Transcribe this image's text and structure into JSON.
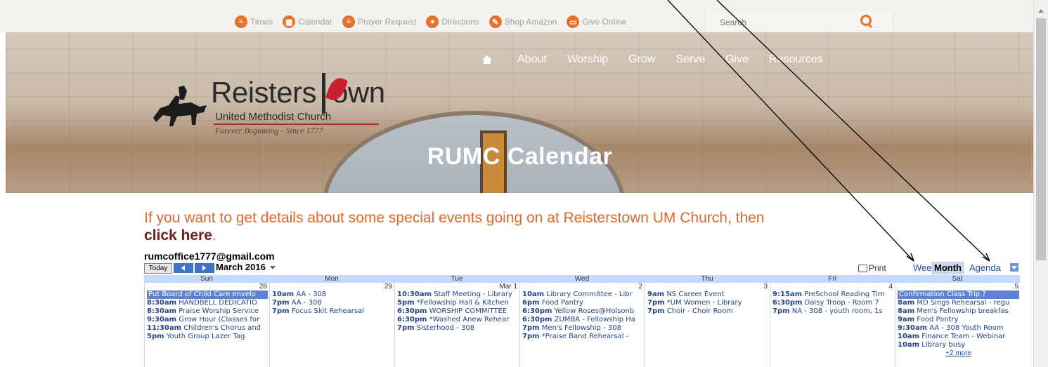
{
  "topbar": {
    "links": [
      {
        "label": "Times",
        "icon": "menu-icon"
      },
      {
        "label": "Calendar",
        "icon": "calendar-icon"
      },
      {
        "label": "Prayer Request",
        "icon": "menu-icon"
      },
      {
        "label": "Directions",
        "icon": "map-pin-icon"
      },
      {
        "label": "Shop Amazon",
        "icon": "pencil-icon"
      },
      {
        "label": "Give Online",
        "icon": "chat-icon"
      }
    ],
    "search_placeholder": "Search"
  },
  "logo": {
    "name_part1": "Reisters",
    "name_part2": "own",
    "subtitle": "United Methodist Church",
    "tagline": "Forever Beginning - Since 1777"
  },
  "nav": {
    "items": [
      "About",
      "Worship",
      "Grow",
      "Serve",
      "Give",
      "Resources"
    ]
  },
  "hero": {
    "title": "RUMC Calendar"
  },
  "intro": {
    "text": "If you want to get details about some special events going on at Reisterstown UM Church, then ",
    "link": "click here",
    "suffix": "."
  },
  "calendar": {
    "owner": "rumcoffice1777@gmail.com",
    "today_label": "Today",
    "month_label": "March 2016",
    "print_label": "Print",
    "views": [
      "Week",
      "Month",
      "Agenda"
    ],
    "active_view": "Month",
    "day_headers": [
      "Sun",
      "Mon",
      "Tue",
      "Wed",
      "Thu",
      "Fri",
      "Sat"
    ],
    "days": [
      {
        "num": "28",
        "events": [
          {
            "allday": true,
            "title": "Put Board of Child Care envelo"
          },
          {
            "time": "8:30am",
            "title": "HANDBELL DEDICATIO"
          },
          {
            "time": "8:30am",
            "title": "Praise Worship Service"
          },
          {
            "time": "9:30am",
            "title": "Grow Hour (Classes for"
          },
          {
            "time": "11:30am",
            "title": "Children's Chorus and"
          },
          {
            "time": "5pm",
            "title": "Youth Group Lazer Tag"
          }
        ]
      },
      {
        "num": "29",
        "events": [
          {
            "time": "10am",
            "title": "AA - 308"
          },
          {
            "time": "7pm",
            "title": "AA - 308"
          },
          {
            "time": "7pm",
            "title": "Focus Skit Rehearsal"
          }
        ]
      },
      {
        "num": "Mar 1",
        "events": [
          {
            "time": "10:30am",
            "title": "Staff Meeting - Library"
          },
          {
            "time": "5pm",
            "title": "*Fellowship Hall & Kitchen"
          },
          {
            "time": "6:30pm",
            "title": "WORSHIP COMMITTEE"
          },
          {
            "time": "6:30pm",
            "title": "*Washed Anew Rehear"
          },
          {
            "time": "7pm",
            "title": "Sisterhood - 308"
          }
        ]
      },
      {
        "num": "2",
        "events": [
          {
            "time": "10am",
            "title": "Library Committee - Libr"
          },
          {
            "time": "6pm",
            "title": "Food Pantry"
          },
          {
            "time": "6:30pm",
            "title": "Yellow Roses@Holsonb"
          },
          {
            "time": "6:30pm",
            "title": "ZUMBA - Fellowship Ha"
          },
          {
            "time": "7pm",
            "title": "Men's Fellowship - 308"
          },
          {
            "time": "7pm",
            "title": "*Praise Band Rehearsal -"
          }
        ]
      },
      {
        "num": "3",
        "events": [
          {
            "time": "9am",
            "title": "NS Career Event"
          },
          {
            "time": "7pm",
            "title": "*UM Women - Library"
          },
          {
            "time": "7pm",
            "title": "Choir - Choir Room"
          }
        ]
      },
      {
        "num": "4",
        "events": [
          {
            "time": "9:15am",
            "title": "PreSchool Reading Tim"
          },
          {
            "time": "6:30pm",
            "title": "Daisy Troop - Room 7"
          },
          {
            "time": "7pm",
            "title": "NA - 308 - youth room, 1s"
          }
        ]
      },
      {
        "num": "5",
        "events": [
          {
            "allday": true,
            "title": "Confirmation Class Trip ?"
          },
          {
            "time": "8am",
            "title": "MD Sings Rehearsal - regu"
          },
          {
            "time": "8am",
            "title": "Men's Fellowship breakfas"
          },
          {
            "time": "9am",
            "title": "Food Pantry"
          },
          {
            "time": "9:30am",
            "title": "AA - 308 Youth Room"
          },
          {
            "time": "10am",
            "title": "Finance Team - Webinar"
          },
          {
            "time": "10am",
            "title": "Library busy"
          }
        ],
        "more": "+2 more"
      }
    ]
  },
  "colors": {
    "accent": "#e8722c",
    "link_dark": "#6b1f1f",
    "calendar_blue": "#c3d9ff",
    "event_text": "#26458c"
  }
}
